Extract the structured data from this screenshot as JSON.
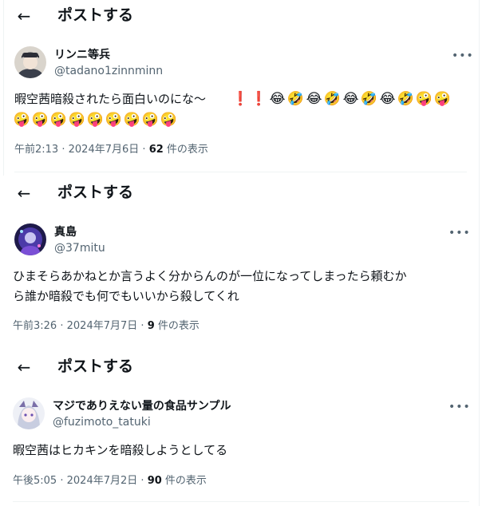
{
  "posts": [
    {
      "header_title": "ポストする",
      "user_name": "リンニ等兵",
      "handle": "@tadano1zinnminn",
      "text_line1": "暇空茜暗殺されたら面白いのにな〜",
      "emoji_line1": [
        "❗",
        "❗",
        "😂",
        "🤣",
        "😂",
        "🤣",
        "😂",
        "🤣",
        "😂",
        "🤣",
        "🤪",
        "🤪"
      ],
      "emoji_line2": [
        "🤪",
        "🤪",
        "🤪",
        "🤪",
        "🤪",
        "🤪",
        "🤪",
        "🤪",
        "🤪"
      ],
      "time": "午前2:13",
      "date": "2024年7月6日",
      "views": "62",
      "views_label": "件の表示"
    },
    {
      "header_title": "ポストする",
      "user_name": "真島",
      "handle": "@37mitu",
      "text_line1": "ひまそらあかねとか言うよく分からんのが一位になってしまったら頼むか",
      "text_line2": "ら誰か暗殺でも何でもいいから殺してくれ",
      "time": "午前3:26",
      "date": "2024年7月7日",
      "views": "9",
      "views_label": "件の表示"
    },
    {
      "header_title": "ポストする",
      "user_name": "マジでありえない量の食品サンプル",
      "handle": "@fuzimoto_tatuki",
      "text_line1": "暇空茜はヒカキンを暗殺しようとしてる",
      "time": "午後5:05",
      "date": "2024年7月2日",
      "views": "90",
      "views_label": "件の表示"
    }
  ],
  "separator": "·",
  "icons": {
    "back": "arrow-left-icon",
    "more": "more-dots-icon"
  }
}
